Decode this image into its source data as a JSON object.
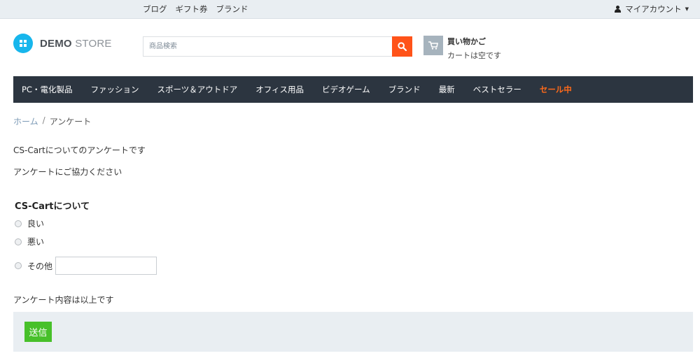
{
  "topbar": {
    "links": [
      "ブログ",
      "ギフト券",
      "ブランド"
    ],
    "account_label": "マイアカウント"
  },
  "logo": {
    "demo": "DEMO",
    "store": "STORE"
  },
  "search": {
    "placeholder": "商品検索",
    "value": ""
  },
  "cart": {
    "title": "買い物かご",
    "status": "カートは空です"
  },
  "nav": {
    "items": [
      "PC・電化製品",
      "ファッション",
      "スポーツ＆アウトドア",
      "オフィス用品",
      "ビデオゲーム",
      "ブランド",
      "最新",
      "ベストセラー",
      "セール中"
    ]
  },
  "breadcrumb": {
    "home": "ホーム",
    "separator": "/",
    "current": "アンケート"
  },
  "survey": {
    "intro": "CS-Cartについてのアンケートです",
    "request": "アンケートにご協力ください",
    "question": "CS-Cartについて",
    "options": [
      "良い",
      "悪い",
      "その他"
    ],
    "other_value": "",
    "closing": "アンケート内容は以上です",
    "submit_label": "送信"
  },
  "colors": {
    "topbar_bg": "#e9eef2",
    "nav_bg": "#2c3540",
    "sale": "#ff6a1a",
    "search_button": "#ff5319",
    "logo_accent": "#17b6ec",
    "submit": "#47c02a"
  }
}
